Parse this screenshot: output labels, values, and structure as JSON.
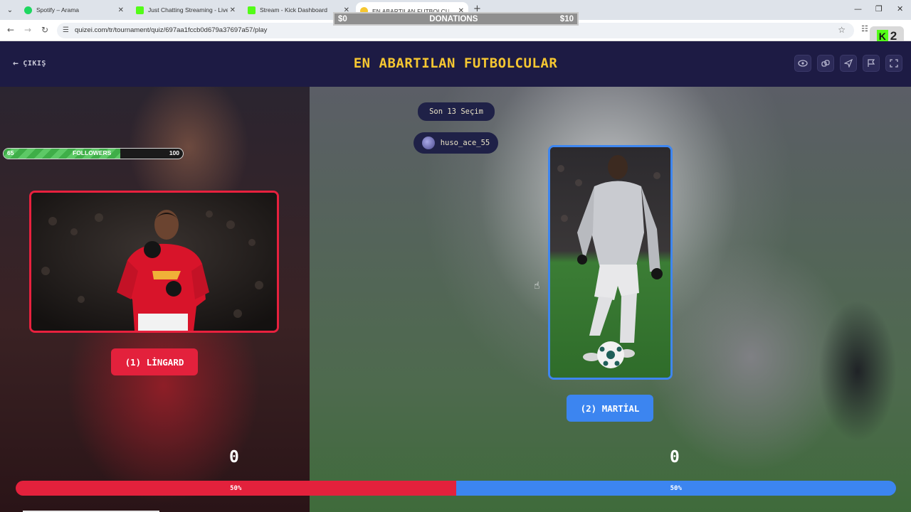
{
  "browser": {
    "tabs": [
      {
        "title": "Spotify – Arama",
        "favicon_color": "#1ed760",
        "active": false
      },
      {
        "title": "Just Chatting Streaming - Live S",
        "favicon_color": "#53fc18",
        "active": false
      },
      {
        "title": "Stream - Kick Dashboard",
        "favicon_color": "#53fc18",
        "active": false
      },
      {
        "title": "EN ABARTILAN FUTBOLCULAR",
        "favicon_color": "#f6c731",
        "active": true
      }
    ],
    "url": "quizei.com/tr/tournament/quiz/697aa1fccb0d679a37697a57/play"
  },
  "overlay": {
    "donations_label": "DONATIONS",
    "donations_min": "$0",
    "donations_max": "$10",
    "kick_count": "2",
    "followers_label": "FOLLOWERS",
    "followers_current": "65",
    "followers_goal": "100",
    "followers_progress": 0.65
  },
  "header": {
    "exit_label": "ÇIKIŞ",
    "title": "EN ABARTILAN FUTBOLCULAR",
    "icons": [
      "eye-icon",
      "link-icon",
      "send-icon",
      "flag-icon",
      "fullscreen-icon"
    ]
  },
  "match": {
    "round_label": "Son 13 Seçim",
    "username": "huso_ace_55",
    "left": {
      "label": "(1) LİNGARD",
      "score": "0",
      "percent_label": "50%",
      "percent": 50,
      "color": "#e3213c"
    },
    "right": {
      "label": "(2) MARTİAL",
      "score": "0",
      "percent_label": "50%",
      "percent": 50,
      "color": "#3c85f0"
    }
  }
}
